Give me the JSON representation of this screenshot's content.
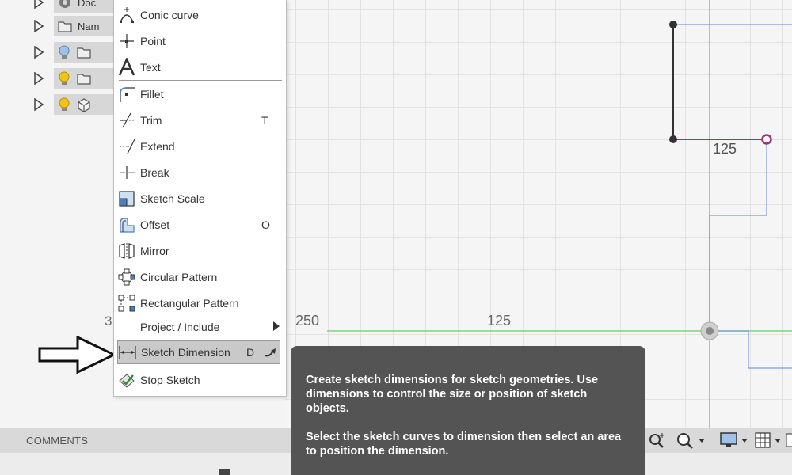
{
  "browser": {
    "rows": [
      {
        "label": "Doc",
        "icon": "gear-icon"
      },
      {
        "label": "Nam",
        "icon": "folder-icon"
      },
      {
        "label": "",
        "icon": "lightbulb-off-icon",
        "icon2": "folder-icon"
      },
      {
        "label": "",
        "icon": "lightbulb-on-icon",
        "icon2": "folder-icon"
      },
      {
        "label": "",
        "icon": "lightbulb-on-icon",
        "icon2": "body-cube-icon"
      }
    ]
  },
  "menu": {
    "items": [
      {
        "label": "Conic curve",
        "shortcut": "",
        "icon": "conic-curve-icon"
      },
      {
        "label": "Point",
        "shortcut": "",
        "icon": "point-icon"
      },
      {
        "label": "Text",
        "shortcut": "",
        "icon": "text-icon"
      },
      {
        "label": "Fillet",
        "shortcut": "",
        "icon": "fillet-icon"
      },
      {
        "label": "Trim",
        "shortcut": "T",
        "icon": "trim-icon"
      },
      {
        "label": "Extend",
        "shortcut": "",
        "icon": "extend-icon"
      },
      {
        "label": "Break",
        "shortcut": "",
        "icon": "break-icon"
      },
      {
        "label": "Sketch Scale",
        "shortcut": "",
        "icon": "sketch-scale-icon"
      },
      {
        "label": "Offset",
        "shortcut": "O",
        "icon": "offset-icon"
      },
      {
        "label": "Mirror",
        "shortcut": "",
        "icon": "mirror-icon"
      },
      {
        "label": "Circular Pattern",
        "shortcut": "",
        "icon": "circular-pattern-icon"
      },
      {
        "label": "Rectangular Pattern",
        "shortcut": "",
        "icon": "rectangular-pattern-icon"
      },
      {
        "label": "Project / Include",
        "shortcut": "",
        "icon": "",
        "submenu": true
      },
      {
        "label": "Sketch Dimension",
        "shortcut": "D",
        "icon": "sketch-dimension-icon",
        "highlighted": true
      },
      {
        "label": "Stop Sketch",
        "shortcut": "",
        "icon": "stop-sketch-icon"
      }
    ]
  },
  "canvas": {
    "dim_top": "125",
    "axis_label_left": "250",
    "axis_label_mid": "125",
    "left_peek": "3"
  },
  "tooltip": {
    "line1": "Create sketch dimensions for sketch geometries. Use dimensions to control the size or position of sketch objects.",
    "line2": "Select the sketch curves to dimension then select an area to position the dimension."
  },
  "bottombar": {
    "comments": "COMMENTS"
  },
  "colors": {
    "highlight": "#c9c9c9",
    "tooltip_bg": "#545454",
    "sketch_line": "#333333",
    "constraint_magenta": "#a0307a",
    "blue_line": "#7c9bd6",
    "green_axis": "#7ed37e",
    "red_axis": "#e06060"
  }
}
